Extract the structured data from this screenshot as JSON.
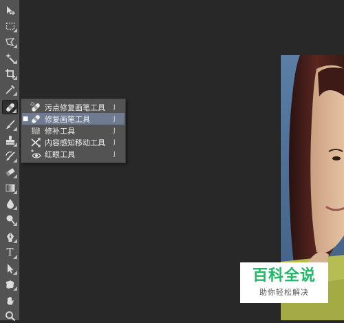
{
  "toolbar": {
    "tools": [
      {
        "name": "move-tool",
        "icon": "move-icon"
      },
      {
        "name": "marquee-tool",
        "icon": "marquee-icon"
      },
      {
        "name": "lasso-tool",
        "icon": "lasso-icon"
      },
      {
        "name": "magic-wand-tool",
        "icon": "magic-wand-icon"
      },
      {
        "name": "crop-tool",
        "icon": "crop-icon"
      },
      {
        "name": "eyedropper-tool",
        "icon": "eyedropper-icon"
      },
      {
        "name": "healing-brush-tool",
        "icon": "bandage-icon",
        "active": true
      },
      {
        "name": "brush-tool",
        "icon": "brush-icon"
      },
      {
        "name": "clone-stamp-tool",
        "icon": "stamp-icon"
      },
      {
        "name": "history-brush-tool",
        "icon": "history-brush-icon"
      },
      {
        "name": "eraser-tool",
        "icon": "eraser-icon"
      },
      {
        "name": "gradient-tool",
        "icon": "gradient-icon"
      },
      {
        "name": "blur-tool",
        "icon": "drop-icon"
      },
      {
        "name": "dodge-tool",
        "icon": "dodge-icon"
      },
      {
        "name": "pen-tool",
        "icon": "pen-icon"
      },
      {
        "name": "type-tool",
        "icon": "type-icon",
        "glyph": "T"
      },
      {
        "name": "path-selection-tool",
        "icon": "arrow-icon"
      },
      {
        "name": "custom-shape-tool",
        "icon": "shape-icon"
      },
      {
        "name": "hand-tool",
        "icon": "hand-icon"
      },
      {
        "name": "zoom-tool",
        "icon": "magnifier-icon"
      }
    ]
  },
  "flyout": {
    "items": [
      {
        "label": "污点修复画笔工具",
        "shortcut": "J",
        "icon": "spot-healing-icon",
        "selected": false
      },
      {
        "label": "修复画笔工具",
        "shortcut": "J",
        "icon": "healing-brush-icon",
        "selected": true,
        "bullet": "■"
      },
      {
        "label": "修补工具",
        "shortcut": "J",
        "icon": "patch-icon",
        "selected": false
      },
      {
        "label": "内容感知移动工具",
        "shortcut": "J",
        "icon": "content-aware-move-icon",
        "selected": false
      },
      {
        "label": "红眼工具",
        "shortcut": "J",
        "icon": "red-eye-icon",
        "selected": false
      }
    ]
  },
  "watermark": {
    "title": "百科全说",
    "subtitle": "助你轻松解决"
  },
  "colors": {
    "canvas_bg": "#282828",
    "toolbar_bg": "#535353",
    "flyout_selected": "#6e7b91",
    "watermark_green": "#1db964"
  }
}
